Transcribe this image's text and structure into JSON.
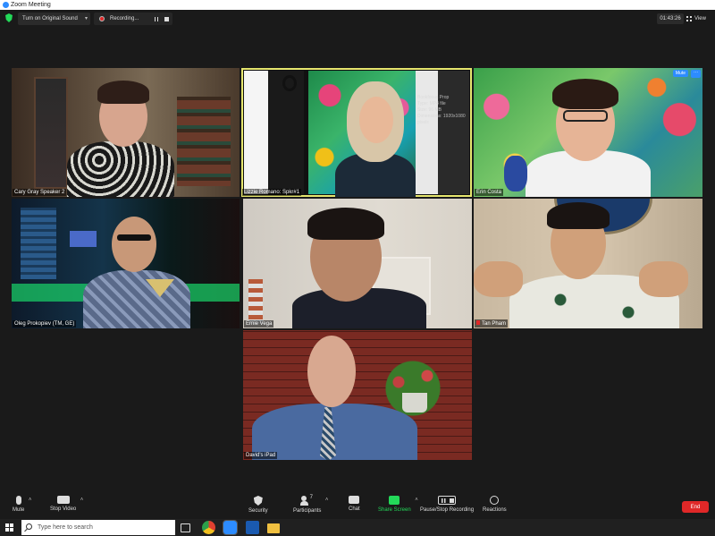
{
  "window": {
    "title": "Zoom Meeting"
  },
  "topbar": {
    "original_sound": "Turn on Original Sound",
    "recording": "Recording...",
    "timer": "01:43:26",
    "view": "View"
  },
  "participants": [
    {
      "name": "Cary Gray Speaker 2"
    },
    {
      "name": "Lizzie Romano: Spkr#1"
    },
    {
      "name": "Erin Costa",
      "mute_badge": "Mute",
      "more_badge": "···"
    },
    {
      "name": "Oleg Prokopiev (TM, GE)"
    },
    {
      "name": "Ernie Vega"
    },
    {
      "name": "Tan Pham"
    },
    {
      "name": "David's iPad"
    }
  ],
  "tile_overlay": {
    "text_lines": [
      "Bookfocus Prop",
      "Type: MP4 file",
      "Size: 96 MB",
      "Dimensions: 1920x1080",
      "pixels"
    ]
  },
  "toolbar": {
    "mute": "Mute",
    "stop_video": "Stop Video",
    "security": "Security",
    "participants": "Participants",
    "participants_count": "7",
    "chat": "Chat",
    "share_screen": "Share Screen",
    "pause_recording": "Pause/Stop Recording",
    "reactions": "Reactions",
    "end": "End"
  },
  "taskbar": {
    "search_placeholder": "Type here to search"
  },
  "colors": {
    "active_speaker": "#e6e66e",
    "share_screen": "#23d959",
    "end": "#e02828",
    "zoom_blue": "#2d8cff"
  }
}
